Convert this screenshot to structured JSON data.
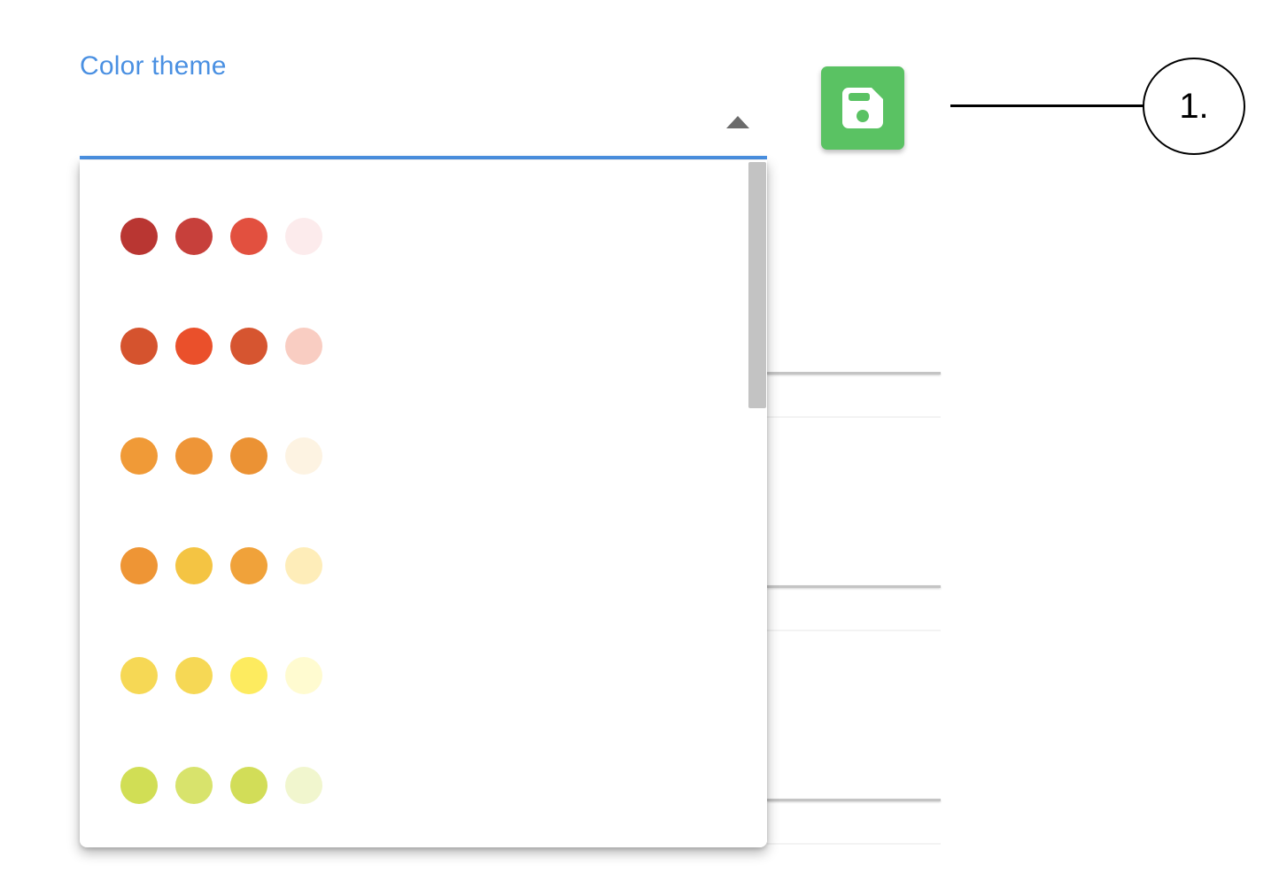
{
  "color_theme_field": {
    "label": "Color theme",
    "accent_color": "#4a90e2",
    "arrow_icon": "triangle-up-icon"
  },
  "save_button": {
    "icon": "floppy-disk-icon",
    "color": "#5ac263"
  },
  "callout": {
    "label": "1."
  },
  "color_options": [
    {
      "swatches": [
        "#b93632",
        "#c7403b",
        "#e2503f",
        "#fcebec"
      ]
    },
    {
      "swatches": [
        "#d5532e",
        "#ea502b",
        "#d65530",
        "#f9cdc2"
      ]
    },
    {
      "swatches": [
        "#f09a37",
        "#ee9537",
        "#eb9234",
        "#fdf3e2"
      ]
    },
    {
      "swatches": [
        "#ee9535",
        "#f4c443",
        "#f0a23a",
        "#feedb9"
      ]
    },
    {
      "swatches": [
        "#f6d855",
        "#f6d855",
        "#fdeb5f",
        "#fffbd0"
      ]
    },
    {
      "swatches": [
        "#d1de55",
        "#d8e36c",
        "#d2dd58",
        "#f1f6ce"
      ]
    }
  ]
}
